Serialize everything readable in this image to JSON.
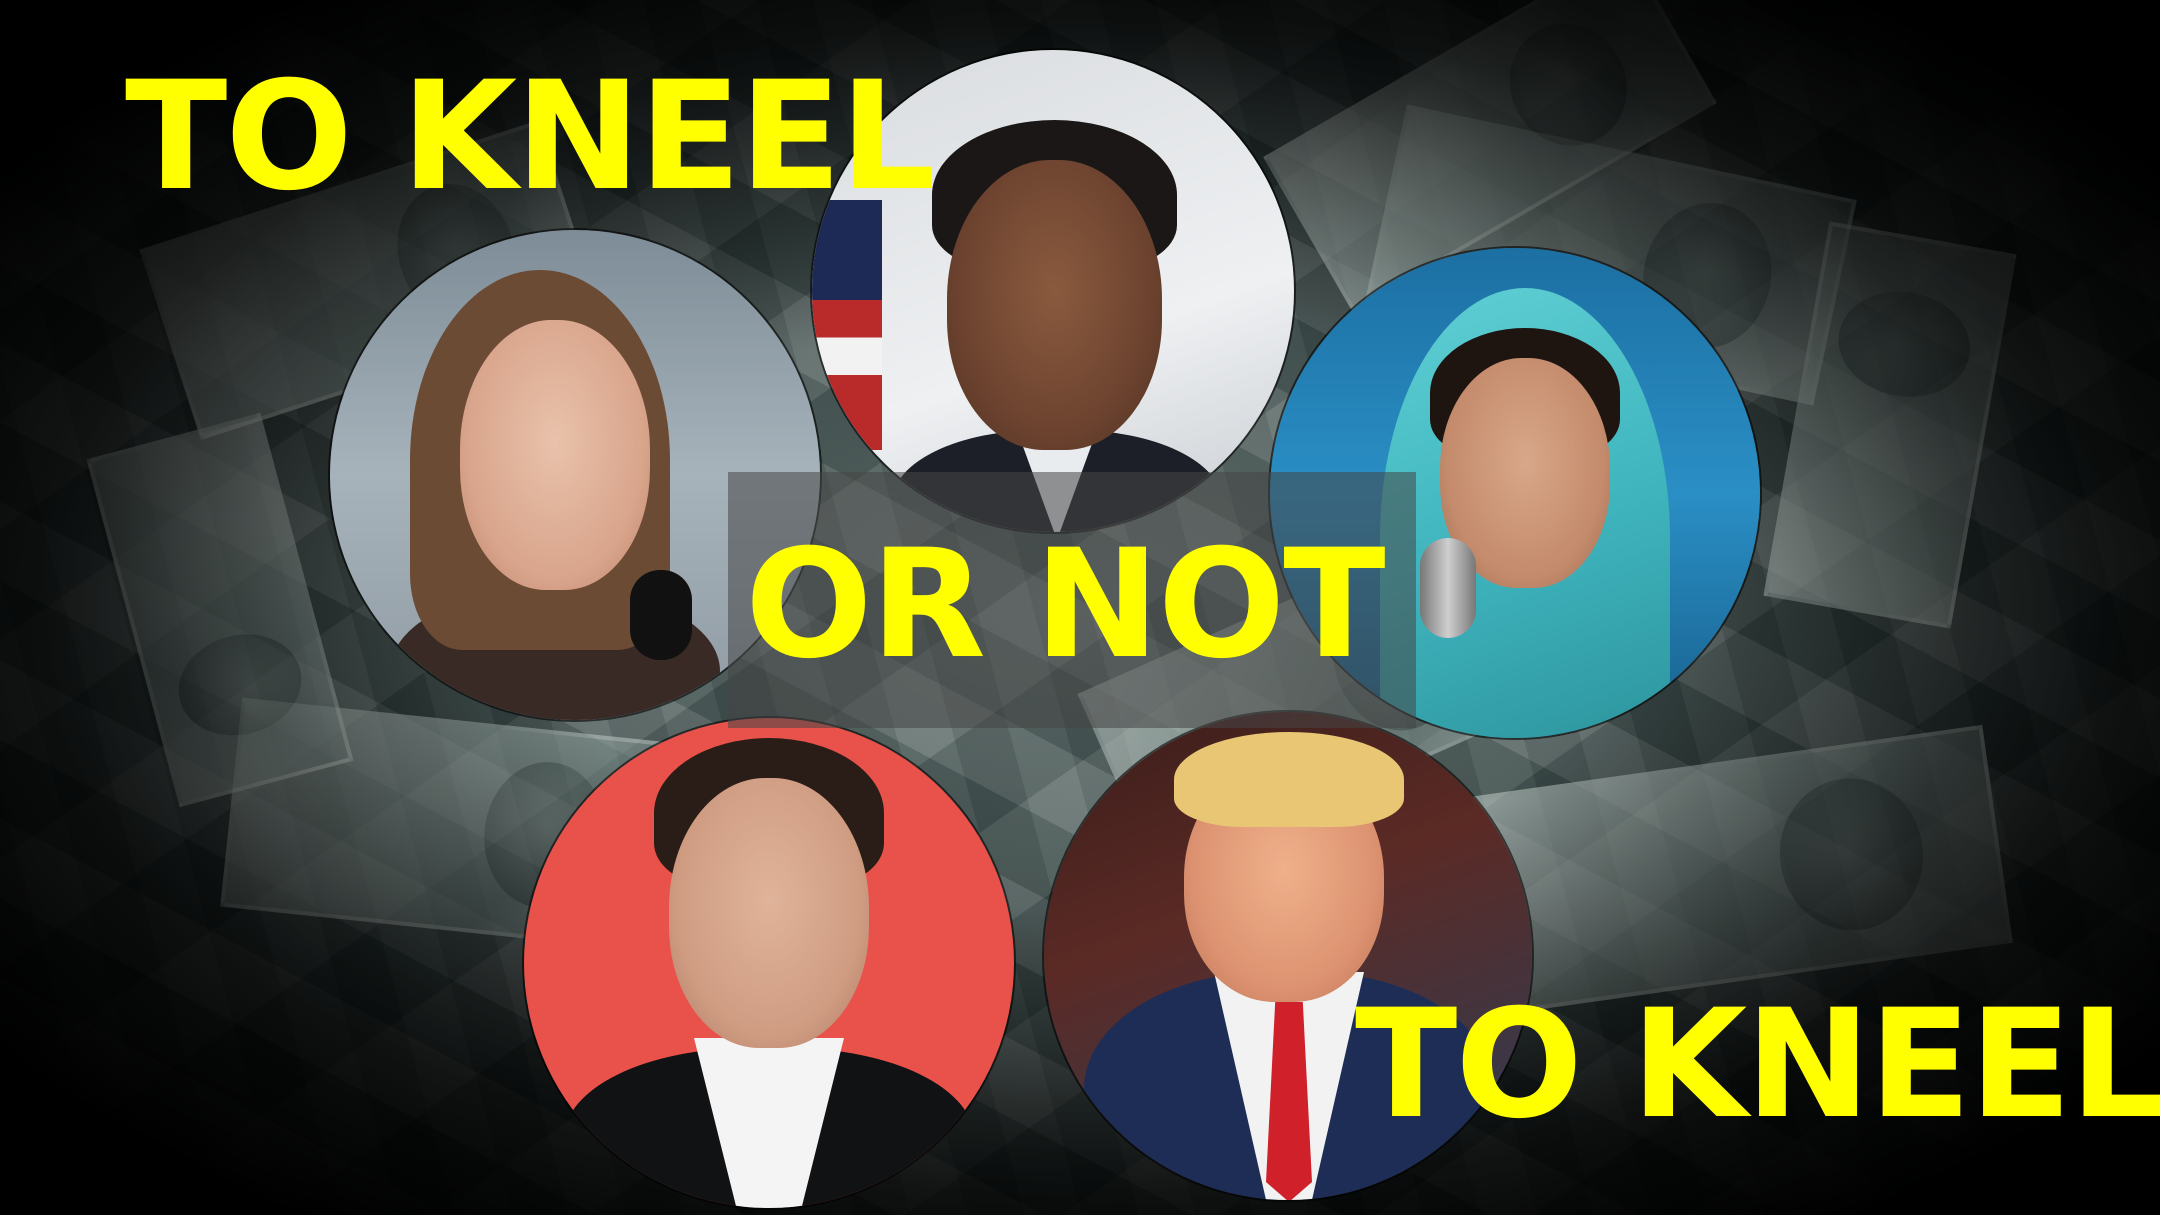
{
  "headlines": {
    "top": "TO KNEEL",
    "middle": "OR NOT",
    "bottom": "TO KNEEL"
  },
  "colors": {
    "headline": "#ffff00",
    "background": "#000000",
    "musk_backdrop": "#e8524a"
  }
}
